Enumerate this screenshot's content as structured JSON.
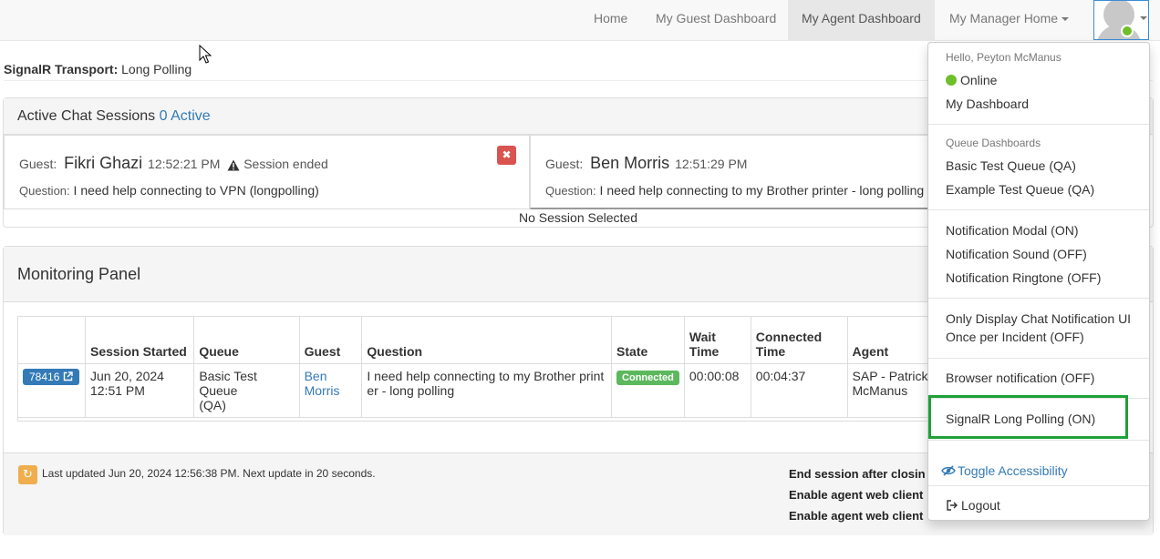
{
  "nav": {
    "home": "Home",
    "guest_dashboard": "My Guest Dashboard",
    "agent_dashboard": "My Agent Dashboard",
    "manager_home": "My Manager Home"
  },
  "transport": {
    "label": "SignalR Transport:",
    "value": "Long Polling"
  },
  "chat_sessions": {
    "title": "Active Chat Sessions",
    "active_count": "0 Active",
    "guest_label": "Guest:",
    "question_label": "Question:",
    "sessions": [
      {
        "guest": "Fikri Ghazi",
        "time": "12:52:21 PM",
        "status": "Session ended",
        "question": "I need help connecting to VPN (longpolling)"
      },
      {
        "guest": "Ben Morris",
        "time": "12:51:29 PM",
        "question": "I need help connecting to my Brother printer - long polling"
      }
    ],
    "no_session": "No Session Selected"
  },
  "monitoring": {
    "title": "Monitoring Panel",
    "columns": {
      "session_started": "Session Started",
      "queue": "Queue",
      "guest": "Guest",
      "question": "Question",
      "state": "State",
      "wait_time_1": "Wait",
      "wait_time_2": "Time",
      "connected_time_1": "Connected",
      "connected_time_2": "Time",
      "agent": "Agent"
    },
    "row": {
      "id": "78416",
      "started_1": "Jun 20, 2024",
      "started_2": "12:51 PM",
      "queue_1": "Basic Test Queue",
      "queue_2": "(QA)",
      "guest_1": "Ben",
      "guest_2": "Morris",
      "question_1": "I need help connecting to my Brother print",
      "question_2": "er - long polling",
      "state": "Connected",
      "wait_time": "00:00:08",
      "connected_time": "00:04:37",
      "agent_1": "SAP - Patrick",
      "agent_2": "McManus"
    },
    "last_updated": "Last updated Jun 20, 2024 12:56:38 PM. Next update in 20 seconds.",
    "options": {
      "end_session": "End session after closin",
      "enable_web_client_1": "Enable agent web client",
      "enable_web_client_2": "Enable agent web client"
    }
  },
  "dropdown": {
    "greeting": "Hello, Peyton McManus",
    "online": "Online",
    "my_dashboard": "My Dashboard",
    "queue_header": "Queue Dashboards",
    "queue_1": "Basic Test Queue (QA)",
    "queue_2": "Example Test Queue (QA)",
    "notif_modal": "Notification Modal (ON)",
    "notif_sound": "Notification Sound (OFF)",
    "notif_ringtone": "Notification Ringtone (OFF)",
    "only_display_1": "Only Display Chat Notification UI",
    "only_display_2": "Once per Incident (OFF)",
    "browser_notif": "Browser notification (OFF)",
    "signalr_long_polling": "SignalR Long Polling (ON)",
    "toggle_accessibility": "Toggle Accessibility",
    "logout": "Logout"
  },
  "colors": {
    "online_green": "#6fbf2a",
    "highlight_green": "#1fa038",
    "link_blue": "#337ab7",
    "danger_red": "#d9534f",
    "success_green": "#5cb85c",
    "warning_orange": "#f0ad4e"
  }
}
